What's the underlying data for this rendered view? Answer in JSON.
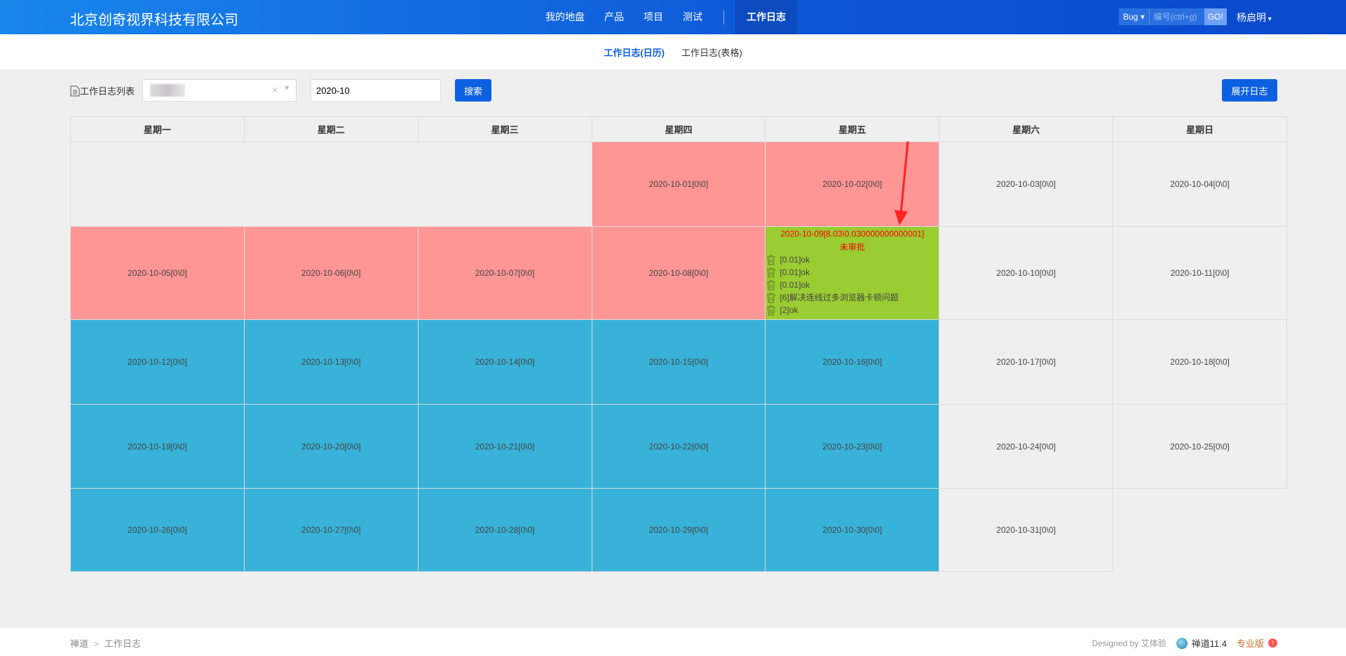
{
  "header": {
    "brand": "北京创奇视界科技有限公司",
    "nav": [
      "我的地盘",
      "产品",
      "项目",
      "测试"
    ],
    "active_nav": "工作日志",
    "quick_search": {
      "type": "Bug",
      "placeholder": "编号(ctrl+g)",
      "go": "GO!"
    },
    "user": "杨启明"
  },
  "subnav": [
    "工作日志(日历)",
    "工作日志(表格)"
  ],
  "toolbar": {
    "list_label": "工作日志列表",
    "date_value": "2020-10",
    "search": "搜索",
    "expand": "展开日志",
    "clear": "×"
  },
  "calendar": {
    "weekdays": [
      "星期一",
      "星期二",
      "星期三",
      "星期四",
      "星期五",
      "星期六",
      "星期日"
    ],
    "colors": {
      "unfilled": "#ff9696",
      "normal": "#38b2d8",
      "pending": "#9acd32",
      "weekend": "#efefef"
    },
    "days": {
      "d01": "2020-10-01[0\\0]",
      "d02": "2020-10-02[0\\0]",
      "d03": "2020-10-03[0\\0]",
      "d04": "2020-10-04[0\\0]",
      "d05": "2020-10-05[0\\0]",
      "d06": "2020-10-06[0\\0]",
      "d07": "2020-10-07[0\\0]",
      "d08": "2020-10-08[0\\0]",
      "d10": "2020-10-10[0\\0]",
      "d11": "2020-10-11[0\\0]",
      "d12": "2020-10-12[0\\0]",
      "d13": "2020-10-13[0\\0]",
      "d14": "2020-10-14[0\\0]",
      "d15": "2020-10-15[0\\0]",
      "d16": "2020-10-16[0\\0]",
      "d17": "2020-10-17[0\\0]",
      "d18": "2020-10-18[0\\0]",
      "d19": "2020-10-19[0\\0]",
      "d20": "2020-10-20[0\\0]",
      "d21": "2020-10-21[0\\0]",
      "d22": "2020-10-22[0\\0]",
      "d23": "2020-10-23[0\\0]",
      "d24": "2020-10-24[0\\0]",
      "d25": "2020-10-25[0\\0]",
      "d26": "2020-10-26[0\\0]",
      "d27": "2020-10-27[0\\0]",
      "d28": "2020-10-28[0\\0]",
      "d29": "2020-10-29[0\\0]",
      "d30": "2020-10-30[0\\0]",
      "d31": "2020-10-31[0\\0]"
    },
    "d09": {
      "title": "2020-10-09[8.03\\0.030000000000001]",
      "status": "未审批",
      "items": [
        "[0.01]ok",
        "[0.01]ok",
        "[0.01]ok",
        "[6]解决连线过多浏览器卡顿问题",
        "[2]ok"
      ]
    }
  },
  "footer": {
    "breadcrumb": [
      "禅道",
      ">",
      "工作日志"
    ],
    "designed": "Designed by 艾体验",
    "version": "禅道11.4",
    "edition": "专业版"
  }
}
